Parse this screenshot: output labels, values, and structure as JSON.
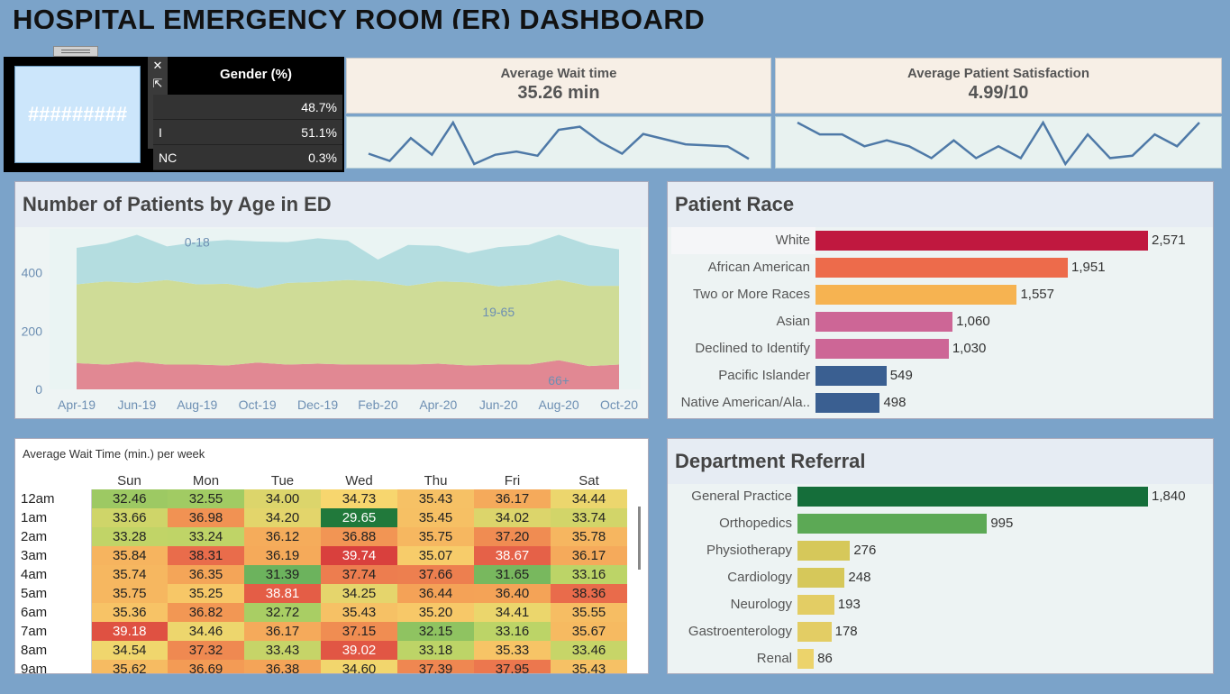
{
  "title": "HOSPITAL EMERGENCY ROOM (ER) DASHBOARD",
  "gender": {
    "header": "Gender (%)",
    "icon_text": "#########",
    "rows": [
      {
        "label": "",
        "value": "48.7%"
      },
      {
        "label": "I",
        "value": "51.1%"
      },
      {
        "label": "NC",
        "value": "0.3%"
      }
    ],
    "toolbar": [
      "close-icon",
      "open-icon",
      "filter-icon",
      "pin-icon",
      "more-icon"
    ]
  },
  "kpis": {
    "wait": {
      "label": "Average Wait time",
      "value": "35.26 min"
    },
    "satisfaction": {
      "label": "Average Patient Satisfaction",
      "value": "4.99/10"
    }
  },
  "colors": {
    "accent_line": "#4e79a7",
    "age_0_18": "#b4dde0",
    "age_19_65": "#cfdc97",
    "age_66": "#e18893"
  },
  "chart_data": [
    {
      "type": "line",
      "series": [
        {
          "values": [
            32.5,
            31.8,
            34.0,
            32.4,
            35.5,
            31.5,
            32.4,
            32.7,
            32.3,
            34.8,
            35.1,
            33.6,
            32.5,
            34.4,
            33.9,
            33.4,
            33.3,
            33.2,
            32.0
          ]
        }
      ],
      "xlabel": "",
      "ylabel": ""
    },
    {
      "type": "line",
      "series": [
        {
          "values": [
            5.1,
            5.0,
            5.0,
            4.9,
            4.95,
            4.9,
            4.8,
            4.95,
            4.8,
            4.9,
            4.8,
            5.1,
            4.75,
            5.0,
            4.8,
            4.82,
            5.0,
            4.9,
            5.1
          ]
        }
      ],
      "xlabel": "",
      "ylabel": ""
    },
    {
      "type": "area",
      "title": "Number of Patients by Age in ED",
      "x": [
        "Apr-19",
        "May-19",
        "Jun-19",
        "Jul-19",
        "Aug-19",
        "Sep-19",
        "Oct-19",
        "Nov-19",
        "Dec-19",
        "Jan-20",
        "Feb-20",
        "Mar-20",
        "Apr-20",
        "May-20",
        "Jun-20",
        "Jul-20",
        "Aug-20",
        "Sep-20",
        "Oct-20"
      ],
      "x_ticks": [
        "Apr-19",
        "Jun-19",
        "Aug-19",
        "Oct-19",
        "Dec-19",
        "Feb-20",
        "Apr-20",
        "Jun-20",
        "Aug-20",
        "Oct-20"
      ],
      "y_ticks": [
        "0",
        "200",
        "400"
      ],
      "ylim": [
        0,
        550
      ],
      "stacked": true,
      "series": [
        {
          "name": "66+",
          "values": [
            90,
            85,
            95,
            85,
            85,
            82,
            92,
            85,
            88,
            85,
            85,
            85,
            88,
            82,
            85,
            85,
            100,
            80,
            85
          ]
        },
        {
          "name": "19-65",
          "values": [
            270,
            285,
            270,
            290,
            275,
            280,
            255,
            280,
            280,
            290,
            285,
            270,
            282,
            285,
            268,
            275,
            275,
            275,
            270
          ]
        },
        {
          "name": "0-18",
          "values": [
            125,
            130,
            165,
            115,
            145,
            150,
            160,
            140,
            150,
            135,
            75,
            140,
            122,
            100,
            135,
            135,
            155,
            140,
            125
          ]
        }
      ]
    },
    {
      "type": "bar",
      "orientation": "horizontal",
      "title": "Patient Race",
      "categories": [
        "White",
        "African American",
        "Two or More Races",
        "Asian",
        "Declined to Identify",
        "Pacific Islander",
        "Native American/Ala.."
      ],
      "values": [
        2571,
        1951,
        1557,
        1060,
        1030,
        549,
        498
      ],
      "value_labels": [
        "2,571",
        "1,951",
        "1,557",
        "1,060",
        "1,030",
        "549",
        "498"
      ],
      "colors": [
        "#c0183f",
        "#ed6b4b",
        "#f6b351",
        "#cd6696",
        "#cd6696",
        "#3a5f91",
        "#3a5f91"
      ]
    },
    {
      "type": "bar",
      "orientation": "horizontal",
      "title": "Department Referral",
      "categories": [
        "General Practice",
        "Orthopedics",
        "Physiotherapy",
        "Cardiology",
        "Neurology",
        "Gastroenterology",
        "Renal"
      ],
      "values": [
        1840,
        995,
        276,
        248,
        193,
        178,
        86
      ],
      "value_labels": [
        "1,840",
        "995",
        "276",
        "248",
        "193",
        "178",
        "86"
      ],
      "colors": [
        "#156e3a",
        "#5ca955",
        "#d6c85a",
        "#d6c85a",
        "#e3cd64",
        "#e3cd64",
        "#ecd36b"
      ]
    },
    {
      "type": "heatmap",
      "title": "Average Wait Time (min.) per week",
      "columns": [
        "Sun",
        "Mon",
        "Tue",
        "Wed",
        "Thu",
        "Fri",
        "Sat"
      ],
      "rows": [
        {
          "label": "12am",
          "values": [
            "32.46",
            "32.55",
            "34.00",
            "34.73",
            "35.43",
            "36.17",
            "34.44"
          ]
        },
        {
          "label": "1am",
          "values": [
            "33.66",
            "36.98",
            "34.20",
            "29.65",
            "35.45",
            "34.02",
            "33.74"
          ]
        },
        {
          "label": "2am",
          "values": [
            "33.28",
            "33.24",
            "36.12",
            "36.88",
            "35.75",
            "37.20",
            "35.78"
          ]
        },
        {
          "label": "3am",
          "values": [
            "35.84",
            "38.31",
            "36.19",
            "39.74",
            "35.07",
            "38.67",
            "36.17"
          ]
        },
        {
          "label": "4am",
          "values": [
            "35.74",
            "36.35",
            "31.39",
            "37.74",
            "37.66",
            "31.65",
            "33.16"
          ]
        },
        {
          "label": "5am",
          "values": [
            "35.75",
            "35.25",
            "38.81",
            "34.25",
            "36.44",
            "36.40",
            "38.36"
          ]
        },
        {
          "label": "6am",
          "values": [
            "35.36",
            "36.82",
            "32.72",
            "35.43",
            "35.20",
            "34.41",
            "35.55"
          ]
        },
        {
          "label": "7am",
          "values": [
            "39.18",
            "34.46",
            "36.17",
            "37.15",
            "32.15",
            "33.16",
            "35.67"
          ]
        },
        {
          "label": "8am",
          "values": [
            "34.54",
            "37.32",
            "33.43",
            "39.02",
            "33.18",
            "35.33",
            "33.46"
          ]
        },
        {
          "label": "9am",
          "values": [
            "35.62",
            "36.69",
            "36.38",
            "34.60",
            "37.39",
            "37.95",
            "35.43"
          ]
        }
      ]
    }
  ]
}
